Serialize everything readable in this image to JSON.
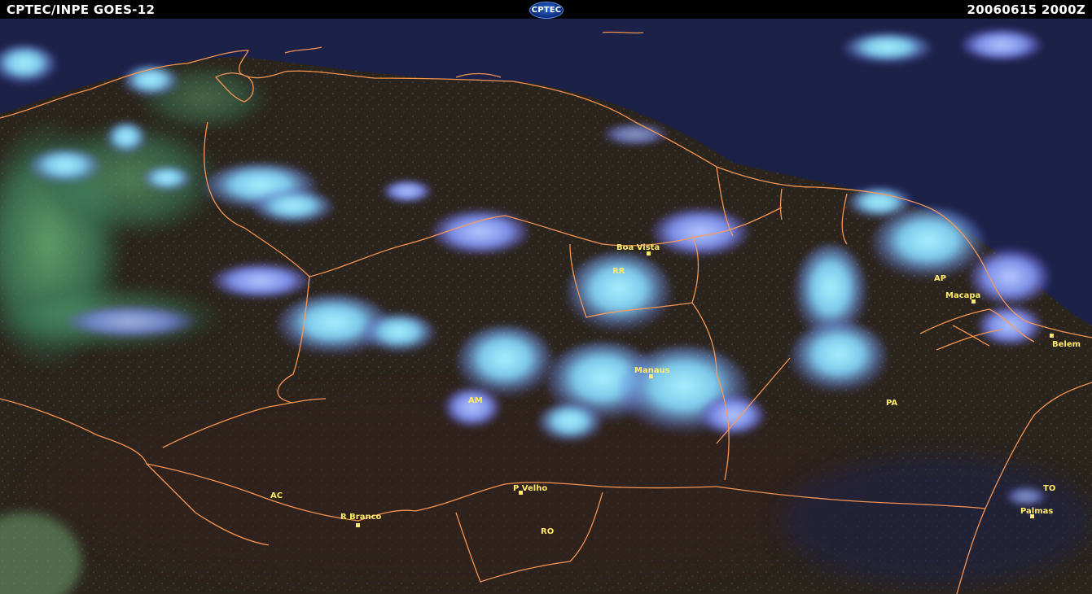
{
  "header": {
    "left_title": "CPTEC/INPE  GOES-12",
    "logo_text": "CPTEC",
    "timestamp": "20060615  2000Z"
  },
  "colors": {
    "header_bg": "#000000",
    "header_text": "#ffffff",
    "label": "#ffe96a",
    "borders": "#ff9a55",
    "ocean": "#1a1f4a",
    "land": "#2a2418",
    "cloud": "#8ad8f0"
  },
  "cities": [
    {
      "name": "Boa Vista"
    },
    {
      "name": "Macapa"
    },
    {
      "name": "Belem"
    },
    {
      "name": "Manaus"
    },
    {
      "name": "P Velho"
    },
    {
      "name": "R Branco"
    },
    {
      "name": "Palmas"
    }
  ],
  "states": [
    {
      "name": "RR"
    },
    {
      "name": "AP"
    },
    {
      "name": "AM"
    },
    {
      "name": "PA"
    },
    {
      "name": "AC"
    },
    {
      "name": "RO"
    },
    {
      "name": "TO"
    }
  ]
}
